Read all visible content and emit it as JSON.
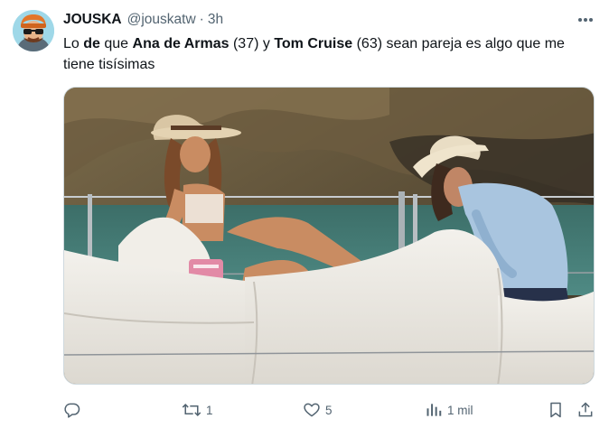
{
  "author": {
    "display_name": "JOUSKA",
    "handle": "@jouskatw",
    "separator": "·",
    "time": "3h",
    "avatar_icon": "cartoon-avatar-sunglasses"
  },
  "tweet": {
    "segments": [
      {
        "text": "Lo ",
        "bold": false
      },
      {
        "text": "de",
        "bold": true
      },
      {
        "text": " que ",
        "bold": false
      },
      {
        "text": "Ana de Armas",
        "bold": true
      },
      {
        "text": " (37) y ",
        "bold": false
      },
      {
        "text": "Tom Cruise",
        "bold": true
      },
      {
        "text": " (63) sean pareja es algo que me tiene tisísimas",
        "bold": false
      }
    ]
  },
  "media": {
    "type": "photo",
    "icon": "photo-couple-on-boat"
  },
  "actions": {
    "reply": {
      "icon": "reply-icon",
      "count": ""
    },
    "retweet": {
      "icon": "retweet-icon",
      "count": "1"
    },
    "like": {
      "icon": "heart-icon",
      "count": "5"
    },
    "views": {
      "icon": "views-icon",
      "count": "1 mil"
    },
    "bookmark": {
      "icon": "bookmark-icon"
    },
    "share": {
      "icon": "share-icon"
    }
  },
  "colors": {
    "text": "#0f1419",
    "secondary": "#536471",
    "border": "#cfd9de"
  }
}
